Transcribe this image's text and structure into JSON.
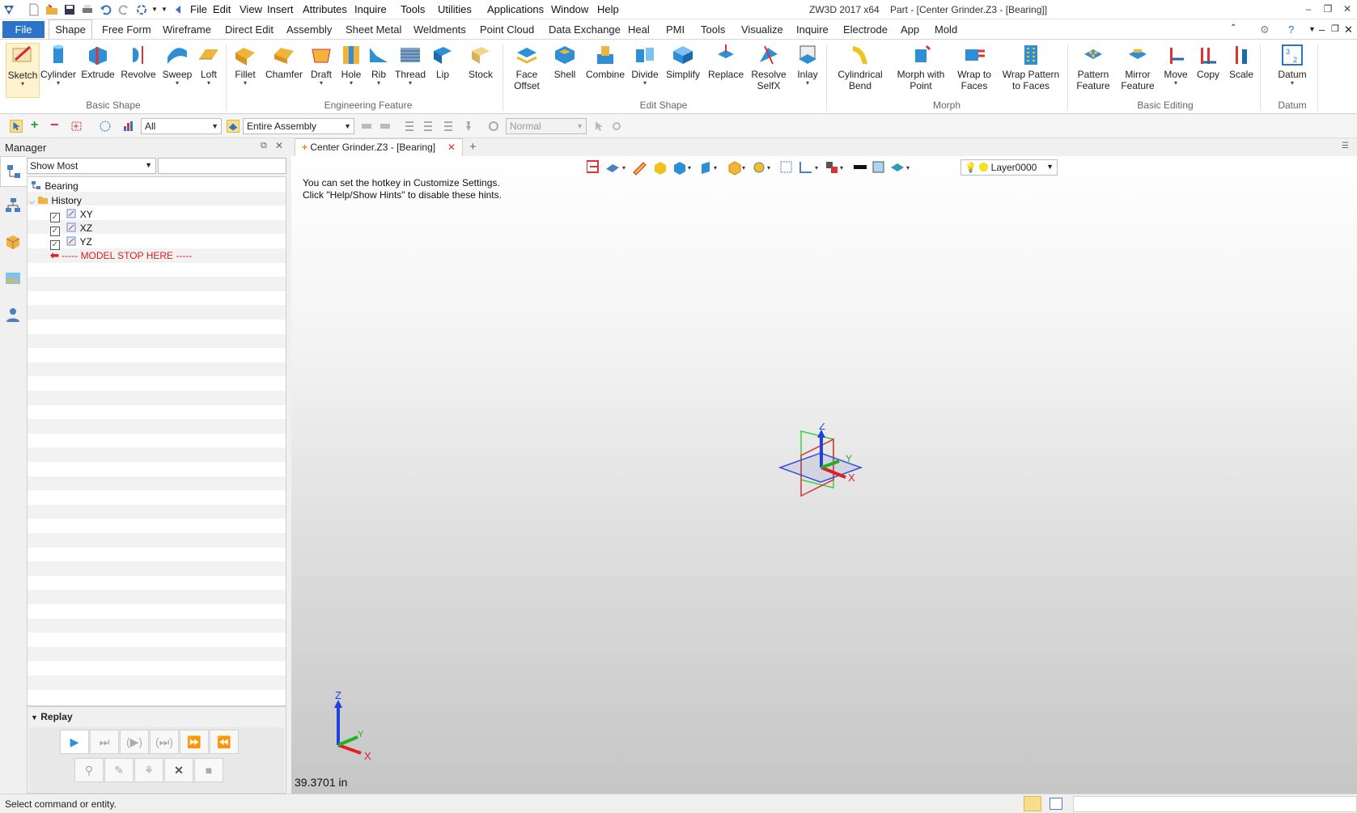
{
  "titlebar": {
    "menus": [
      "File",
      "Edit",
      "View",
      "Insert",
      "Attributes",
      "Inquire",
      "Tools",
      "Utilities",
      "Applications",
      "Window",
      "Help"
    ],
    "app_name": "ZW3D 2017  x64",
    "document_title": "Part - [Center Grinder.Z3 - [Bearing]]"
  },
  "ribbon_tabs": {
    "file": "File",
    "active": "Shape",
    "tabs": [
      "Free Form",
      "Wireframe",
      "Direct Edit",
      "Assembly",
      "Sheet Metal",
      "Weldments",
      "Point Cloud",
      "Data Exchange",
      "Heal",
      "PMI",
      "Tools",
      "Visualize",
      "Inquire",
      "Electrode",
      "App",
      "Mold"
    ]
  },
  "ribbon": {
    "groups": {
      "basic_shape": "Basic Shape",
      "engineering_feature": "Engineering Feature",
      "edit_shape": "Edit Shape",
      "morph": "Morph",
      "basic_editing": "Basic Editing",
      "datum": "Datum"
    },
    "buttons": {
      "sketch": "Sketch",
      "cylinder": "Cylinder",
      "extrude": "Extrude",
      "revolve": "Revolve",
      "sweep": "Sweep",
      "loft": "Loft",
      "fillet": "Fillet",
      "chamfer": "Chamfer",
      "draft": "Draft",
      "hole": "Hole",
      "rib": "Rib",
      "thread": "Thread",
      "lip": "Lip",
      "stock": "Stock",
      "face_offset_1": "Face",
      "face_offset_2": "Offset",
      "shell": "Shell",
      "combine": "Combine",
      "divide": "Divide",
      "simplify": "Simplify",
      "replace": "Replace",
      "resolve_1": "Resolve",
      "resolve_2": "SelfX",
      "inlay": "Inlay",
      "cyl_bend_1": "Cylindrical",
      "cyl_bend_2": "Bend",
      "morph_point_1": "Morph with",
      "morph_point_2": "Point",
      "wrap_faces_1": "Wrap to",
      "wrap_faces_2": "Faces",
      "wrap_pattern_1": "Wrap Pattern",
      "wrap_pattern_2": "to Faces",
      "pattern_1": "Pattern",
      "pattern_2": "Feature",
      "mirror_1": "Mirror",
      "mirror_2": "Feature",
      "move": "Move",
      "copy": "Copy",
      "scale": "Scale",
      "datum": "Datum"
    }
  },
  "toolbar": {
    "filter_value": "All",
    "scope_value": "Entire Assembly",
    "mode_value": "Normal"
  },
  "manager": {
    "title": "Manager",
    "filter_value": "Show Most",
    "tree": {
      "root": "Bearing",
      "history": "History",
      "planes": [
        "XY",
        "XZ",
        "YZ"
      ],
      "stop_marker": "----- MODEL STOP HERE -----"
    },
    "replay_title": "Replay"
  },
  "document": {
    "tab_label": "Center Grinder.Z3 - [Bearing]",
    "hint_line1": "You can set the hotkey in Customize Settings.",
    "hint_line2": "Click \"Help/Show Hints\" to disable these hints.",
    "layer": "Layer0000",
    "distance": "39.3701 in",
    "axis_labels": {
      "x": "X",
      "y": "Y",
      "z": "Z"
    }
  },
  "status": {
    "text": "Select command or entity."
  },
  "colors": {
    "accent": "#2b74c7",
    "stop_marker": "#d62020",
    "axis_x": "#e02020",
    "axis_y": "#20b020",
    "axis_z": "#2040e0"
  }
}
